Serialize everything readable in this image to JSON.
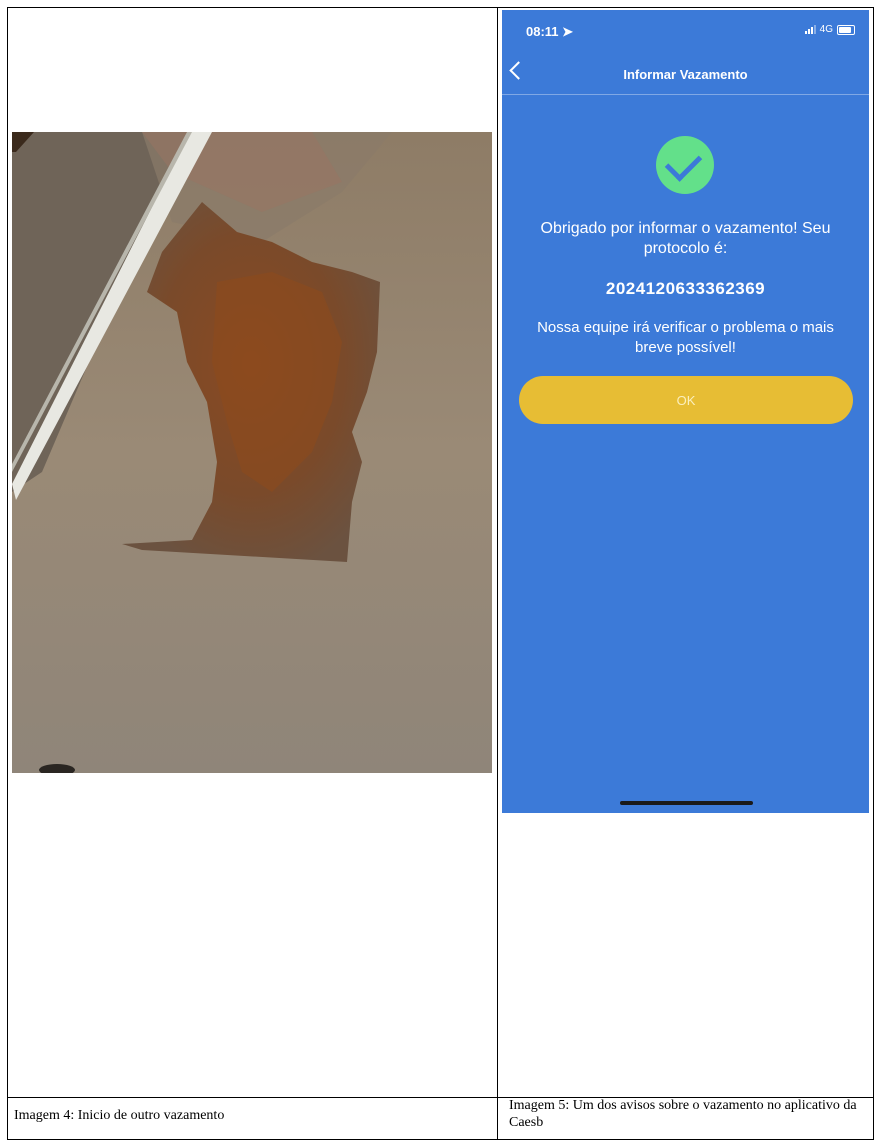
{
  "left_cell": {
    "caption": "Imagem 4: Inicio de outro vazamento",
    "photo_alt": "asphalt street with rusty-wet patch beside white curb"
  },
  "right_cell": {
    "caption": "Imagem 5: Um dos avisos sobre o vazamento no aplicativo da Caesb"
  },
  "phone": {
    "status": {
      "time": "08:11",
      "network": "4G"
    },
    "nav_title": "Informar Vazamento",
    "message": "Obrigado por informar o vazamento! Seu protocolo é:",
    "protocol_number": "2024120633362369",
    "followup": "Nossa equipe irá verificar o problema o mais breve possível!",
    "ok_label": "OK"
  },
  "colors": {
    "phone_bg": "#3c7ad8",
    "check_bg": "#63e08a",
    "button": "#e7bd34"
  }
}
